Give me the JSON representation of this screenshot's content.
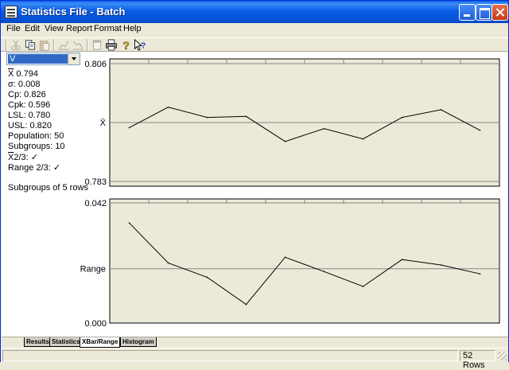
{
  "window": {
    "title": "Statistics File - Batch"
  },
  "menu": [
    "File",
    "Edit",
    "View",
    "Report",
    "Format",
    "Help"
  ],
  "toolbar": {
    "icons": [
      "cut-icon",
      "copy-icon",
      "paste-icon",
      "chart-ascending-icon",
      "chart-descending-icon",
      "new-icon",
      "print-icon",
      "help-icon",
      "whats-this-icon"
    ]
  },
  "combo": {
    "selected": "V"
  },
  "stats": {
    "xbar": "0.794",
    "sigma": "0.008",
    "cp": "Cp: 0.826",
    "cpk": "Cpk: 0.596",
    "lsl": "LSL: 0.780",
    "usl": "USL: 0.820",
    "population": "Population: 50",
    "subgroups": "Subgroups: 10",
    "xbar_rule": "2/3: ✓",
    "range_rule": "Range 2/3: ✓",
    "subgroup_size": "Subgroups of 5 rows"
  },
  "chart_data": [
    {
      "type": "line",
      "ylabel": "X̄",
      "ylim": [
        0.783,
        0.806
      ],
      "ytick_labels": [
        "0.806",
        "0.783"
      ],
      "center_line": 0.7945,
      "x": [
        1,
        2,
        3,
        4,
        5,
        6,
        7,
        8,
        9,
        10
      ],
      "values": [
        0.7935,
        0.7975,
        0.7955,
        0.7957,
        0.7908,
        0.7933,
        0.7913,
        0.7955,
        0.797,
        0.793
      ]
    },
    {
      "type": "line",
      "ylabel": "Range",
      "ylim": [
        0.0,
        0.042
      ],
      "ytick_labels": [
        "0.042",
        "0.000"
      ],
      "center_line": 0.019,
      "x": [
        1,
        2,
        3,
        4,
        5,
        6,
        7,
        8,
        9,
        10
      ],
      "values": [
        0.035,
        0.021,
        0.016,
        0.0065,
        0.023,
        0.018,
        0.0128,
        0.0222,
        0.0203,
        0.0172
      ]
    }
  ],
  "tabs": [
    "Results",
    "Statistics",
    "XBar/Range",
    "Histogram"
  ],
  "active_tab": "XBar/Range",
  "status": {
    "rows": "52 Rows"
  },
  "colors": {
    "plot_bg": "#ece9d8",
    "line": "#000000",
    "title_bar": "#0a5de6",
    "selection": "#316ac5"
  }
}
